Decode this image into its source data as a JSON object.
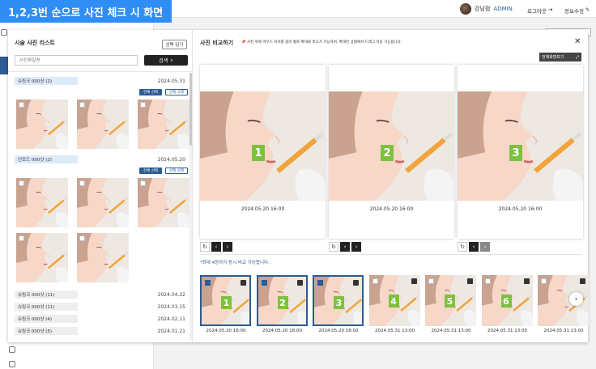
{
  "caption": "1,2,3번 순으로 사진 체크 시 화면",
  "header": {
    "user_name": "강남점",
    "user_role": "ADMIN",
    "logout_label": "로그아웃",
    "myinfo_label": "정보수정"
  },
  "left_panel": {
    "title": "시술 사진 리스트",
    "select_button": "선택 담기",
    "search_placeholder": "사진파일명",
    "search_button": "검색",
    "groups": [
      {
        "name": "슈링크 000샷 (2)",
        "date": "2024.05.31",
        "select_all": "전체 선택",
        "select_delete": "선택 삭제",
        "photo_count": 3
      },
      {
        "name": "인모드 000샷 (2)",
        "date": "2024.05.20",
        "select_all": "전체 선택",
        "select_delete": "선택 삭제",
        "photo_count": 5
      }
    ],
    "history": [
      {
        "name": "슈링크 000샷 (11)",
        "date": "2024.04.22"
      },
      {
        "name": "슈링크 000샷 (11)",
        "date": "2024.03.15"
      },
      {
        "name": "슈링크 000샷 (4)",
        "date": "2024.02.11"
      },
      {
        "name": "슈링크 000샷 (5)",
        "date": "2024.01.21"
      }
    ]
  },
  "right_panel": {
    "title": "사진 비교하기",
    "note": "📌 사진 위에 마우스 커서를 올려 휠로 확대와 축소가 가능하며, 확대된 상태에서 드래그 이동 가능합니다.",
    "fullscreen_label": "전체화면보기",
    "compare_cards": [
      {
        "number": "1",
        "date": "2024.05.20 16:00"
      },
      {
        "number": "2",
        "date": "2024.05.20 16:00"
      },
      {
        "number": "3",
        "date": "2024.05.20 16:00"
      }
    ],
    "max_note": "*최대 4장까지 동시 비교 가능합니다.",
    "strip": [
      {
        "number": "1",
        "date": "2024.05.20 16:00",
        "checked": true
      },
      {
        "number": "2",
        "date": "2024.05.20 16:00",
        "checked": true
      },
      {
        "number": "3",
        "date": "2024.05.20 16:00",
        "checked": true
      },
      {
        "number": "4",
        "date": "2024.05.31 13:00",
        "checked": false
      },
      {
        "number": "5",
        "date": "2024.05.31 13:00",
        "checked": false
      },
      {
        "number": "6",
        "date": "2024.05.31 13:00",
        "checked": false
      },
      {
        "number": "",
        "date": "2024.05.31 13:00",
        "checked": false
      }
    ]
  },
  "colors": {
    "caption_bg": "#2e8ef5",
    "accent": "#2d5b93",
    "number_badge": "#7cc240",
    "group_highlight": "#dceafa"
  }
}
